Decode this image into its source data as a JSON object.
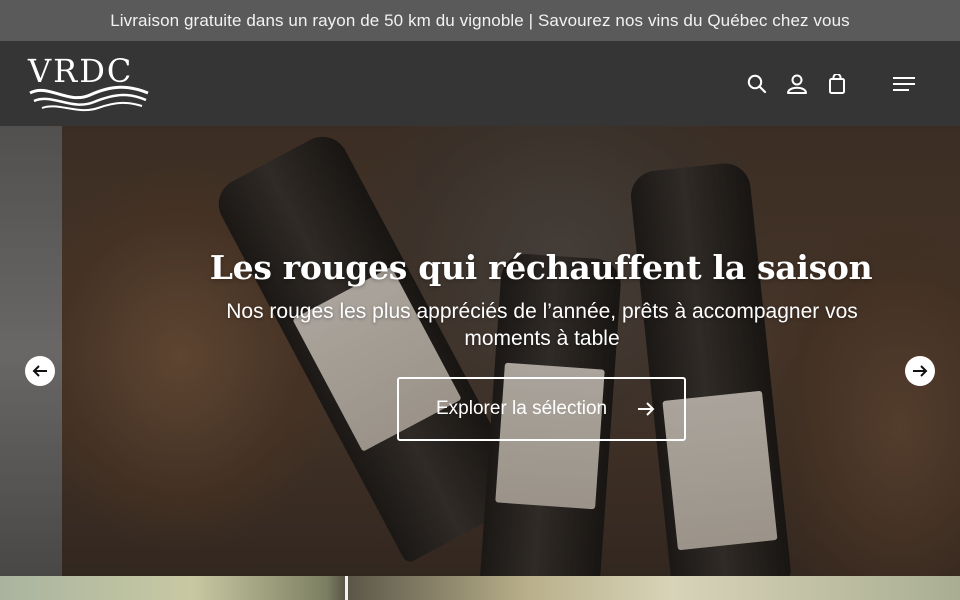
{
  "announcement": {
    "text": "Livraison gratuite dans un rayon de 50 km du vignoble | Savourez nos vins du Québec chez vous"
  },
  "header": {
    "logo_text": "VRDC",
    "icons": [
      "search-icon",
      "account-icon",
      "cart-icon",
      "menu-icon"
    ]
  },
  "hero": {
    "title": "Les rouges qui réchauffent la saison",
    "subtitle": "Nos rouges les plus appréciés de l’année, prêts à accompagner vos moments à table",
    "cta_label": "Explorer la sélection"
  },
  "colors": {
    "topbar": "#5a5a5a",
    "header": "#353535",
    "text": "#ffffff"
  }
}
